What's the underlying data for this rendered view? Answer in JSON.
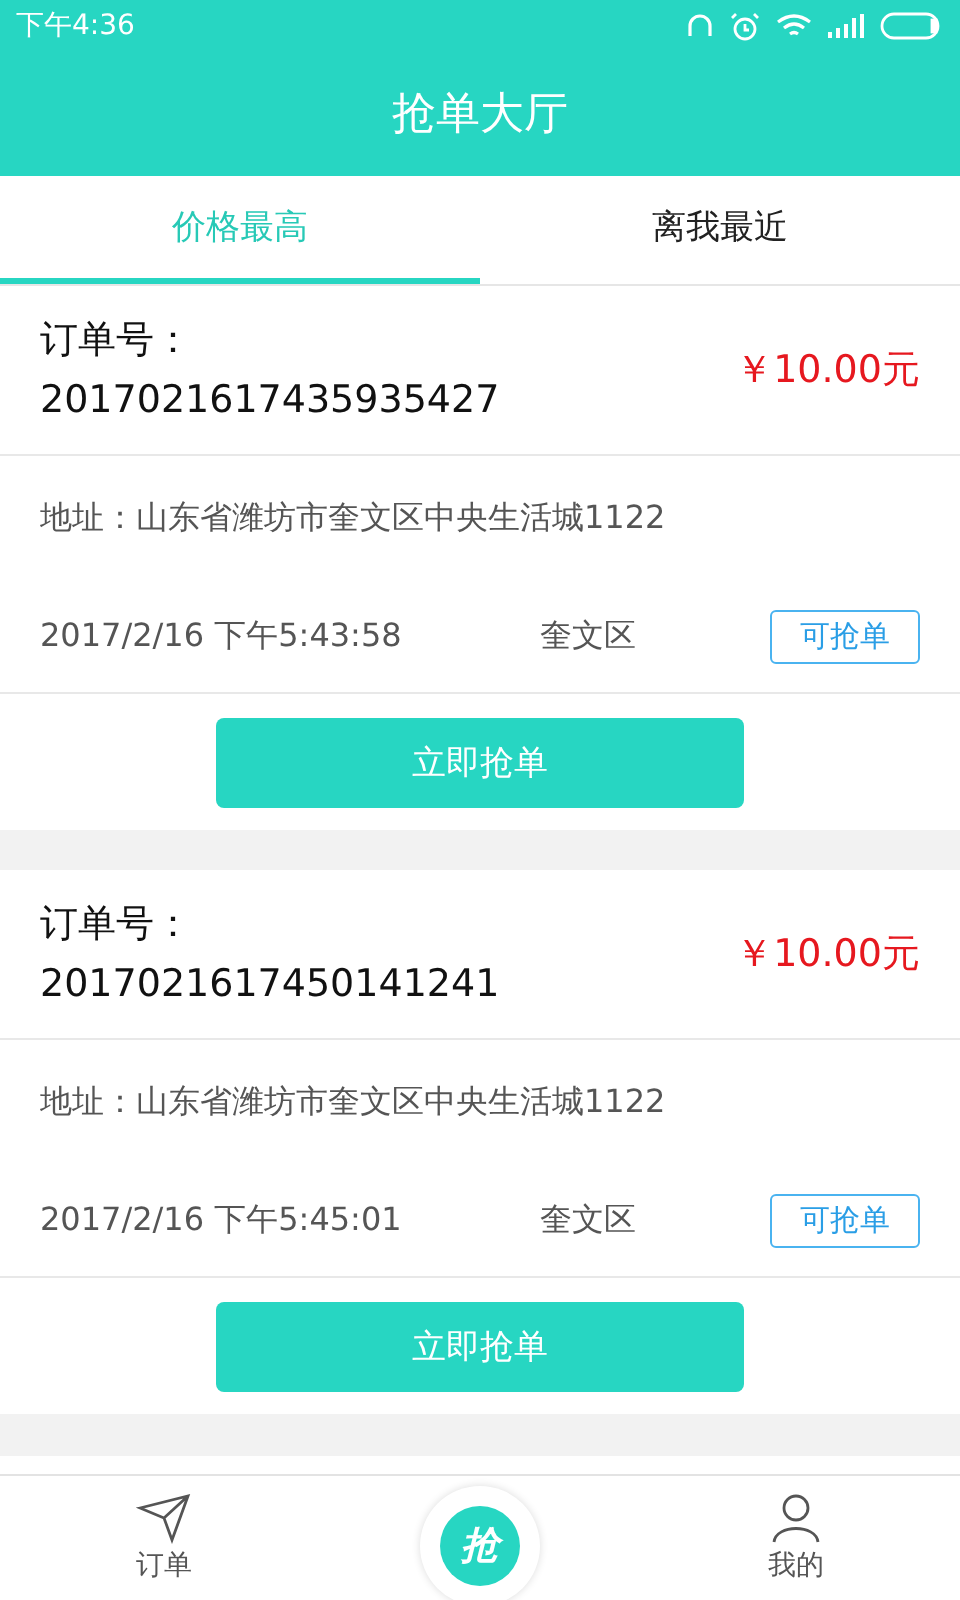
{
  "status_bar": {
    "time": "下午4:36"
  },
  "header": {
    "title": "抢单大厅"
  },
  "tabs": [
    {
      "label": "价格最高",
      "selected": true
    },
    {
      "label": "离我最近",
      "selected": false
    }
  ],
  "orders": [
    {
      "number_label": "订单号：",
      "number": "2017021617435935427",
      "price": "￥10.00元",
      "address": "地址：山东省潍坊市奎文区中央生活城1122",
      "time": "2017/2/16 下午5:43:58",
      "district": "奎文区",
      "status": "可抢单",
      "action": "立即抢单"
    },
    {
      "number_label": "订单号：",
      "number": "2017021617450141241",
      "price": "￥10.00元",
      "address": "地址：山东省潍坊市奎文区中央生活城1122",
      "time": "2017/2/16 下午5:45:01",
      "district": "奎文区",
      "status": "可抢单",
      "action": "立即抢单"
    }
  ],
  "bottom_nav": {
    "items": [
      {
        "label": "订单",
        "kind": "orders"
      },
      {
        "label": "抢",
        "kind": "grab"
      },
      {
        "label": "我的",
        "kind": "profile"
      }
    ]
  }
}
